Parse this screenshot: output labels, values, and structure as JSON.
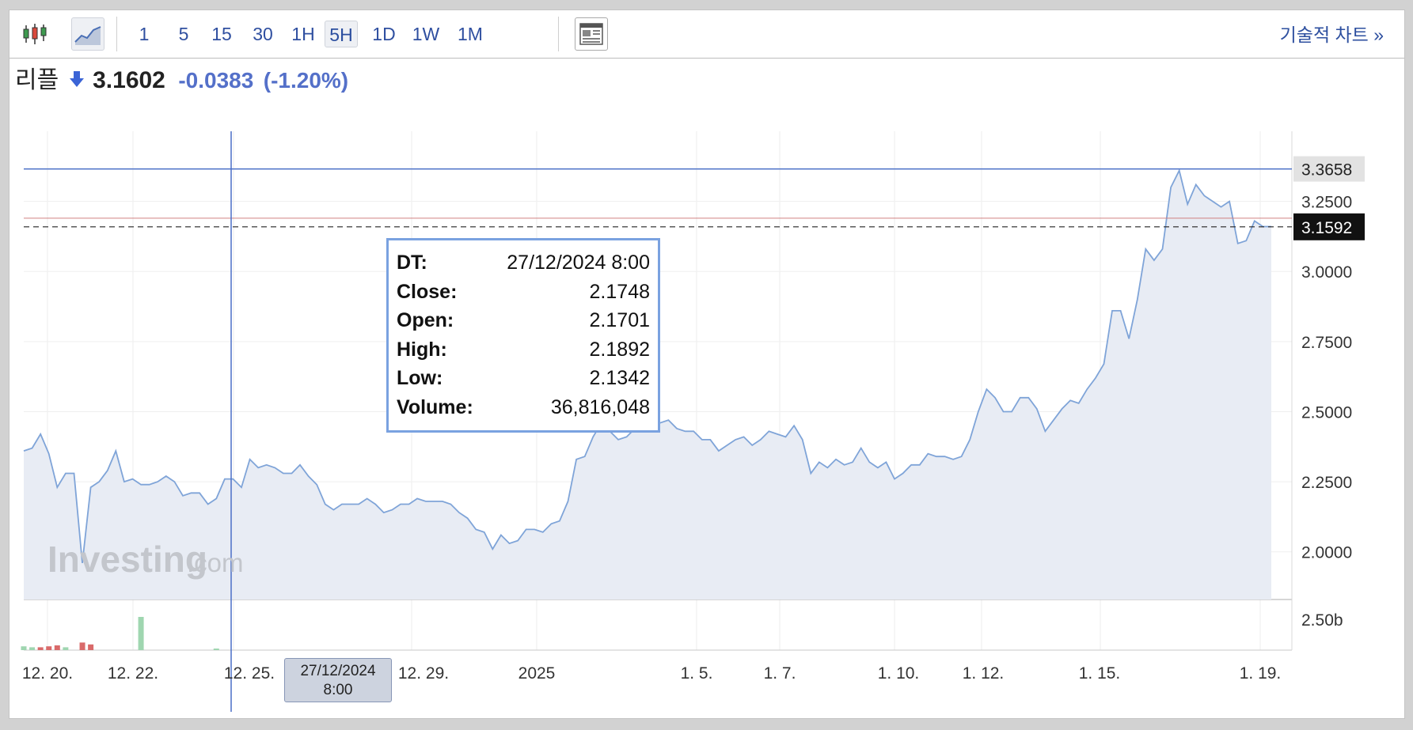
{
  "toolbar": {
    "intervals": [
      "1",
      "5",
      "15",
      "30",
      "1H",
      "5H",
      "1D",
      "1W",
      "1M"
    ],
    "active_interval": "5H",
    "tech_chart_link": "기술적 차트 »",
    "icons": [
      "candlestick-chart-icon",
      "area-chart-icon",
      "news-layout-icon"
    ]
  },
  "quote": {
    "name": "리플",
    "direction": "down",
    "price": "3.1602",
    "change": "-0.0383",
    "change_pct": "(-1.20%)"
  },
  "tooltip": {
    "rows": [
      {
        "label": "DT:",
        "value": "27/12/2024 8:00"
      },
      {
        "label": "Close:",
        "value": "2.1748"
      },
      {
        "label": "Open:",
        "value": "2.1701"
      },
      {
        "label": "High:",
        "value": "2.1892"
      },
      {
        "label": "Low:",
        "value": "2.1342"
      },
      {
        "label": "Volume:",
        "value": "36,816,048"
      }
    ]
  },
  "crosshair_label": {
    "line1": "27/12/2024",
    "line2": "8:00"
  },
  "watermark": {
    "brand": "Investing",
    "suffix": ".com"
  },
  "colors": {
    "accent": "#5470c9",
    "line": "#7fa4d8",
    "area": "#e8ecf4",
    "high_line": "#4a6fc7",
    "low_marker": "#d08080",
    "vol_up": "#9fd6b0",
    "vol_down": "#d96a6a"
  },
  "chart_data": {
    "type": "area",
    "ylim": [
      1.83,
      3.5
    ],
    "y_ticks": [
      2.0,
      2.25,
      2.5,
      2.75,
      3.0,
      3.25
    ],
    "y_tick_labels": [
      "2.0000",
      "2.2500",
      "2.5000",
      "2.7500",
      "3.0000",
      "3.2500"
    ],
    "x_tick_labels": [
      "12. 20.",
      "12. 22.",
      "12. 25.",
      "12. 29.",
      "2025",
      "1. 5.",
      "1. 7.",
      "1. 10.",
      "1. 12.",
      "1. 15.",
      "1. 19."
    ],
    "high_marker": {
      "value": 3.3658,
      "label": "3.3658"
    },
    "last_price": {
      "value": 3.1592,
      "label": "3.1592"
    },
    "volume_scale_label": "2.50b",
    "close": [
      2.36,
      2.37,
      2.42,
      2.35,
      2.23,
      2.28,
      2.28,
      1.96,
      2.23,
      2.25,
      2.29,
      2.36,
      2.25,
      2.26,
      2.24,
      2.24,
      2.25,
      2.27,
      2.25,
      2.2,
      2.21,
      2.21,
      2.17,
      2.19,
      2.26,
      2.26,
      2.23,
      2.33,
      2.3,
      2.31,
      2.3,
      2.28,
      2.28,
      2.31,
      2.27,
      2.24,
      2.17,
      2.15,
      2.17,
      2.17,
      2.17,
      2.19,
      2.17,
      2.14,
      2.15,
      2.17,
      2.17,
      2.19,
      2.18,
      2.18,
      2.18,
      2.17,
      2.14,
      2.12,
      2.08,
      2.07,
      2.01,
      2.06,
      2.03,
      2.04,
      2.08,
      2.08,
      2.07,
      2.1,
      2.11,
      2.18,
      2.33,
      2.34,
      2.41,
      2.46,
      2.43,
      2.4,
      2.41,
      2.44,
      2.46,
      2.45,
      2.46,
      2.47,
      2.44,
      2.43,
      2.43,
      2.4,
      2.4,
      2.36,
      2.38,
      2.4,
      2.41,
      2.38,
      2.4,
      2.43,
      2.42,
      2.41,
      2.45,
      2.4,
      2.28,
      2.32,
      2.3,
      2.33,
      2.31,
      2.32,
      2.37,
      2.32,
      2.3,
      2.32,
      2.26,
      2.28,
      2.31,
      2.31,
      2.35,
      2.34,
      2.34,
      2.33,
      2.34,
      2.4,
      2.5,
      2.58,
      2.55,
      2.5,
      2.5,
      2.55,
      2.55,
      2.51,
      2.43,
      2.47,
      2.51,
      2.54,
      2.53,
      2.58,
      2.62,
      2.67,
      2.86,
      2.86,
      2.76,
      2.9,
      3.08,
      3.04,
      3.08,
      3.3,
      3.36,
      3.24,
      3.31,
      3.27,
      3.25,
      3.23,
      3.25,
      3.1,
      3.11,
      3.18,
      3.16,
      3.16
    ],
    "volume": [
      0.04,
      0.03,
      0.03,
      0.04,
      0.05,
      0.03,
      0.0,
      0.08,
      0.06,
      0.0,
      0.0,
      0.0,
      0.0,
      0.0,
      0.35,
      0.0,
      0.0,
      0.0,
      0.0,
      0.0,
      0.0,
      0.0,
      0.0,
      0.01,
      0.0,
      0.0,
      0.0,
      0.0,
      0.0,
      0.0,
      0.0,
      0.0,
      0.0,
      0.0,
      0.0,
      0.0,
      0.0,
      0.0,
      0.0,
      0.0,
      0.0,
      0.0,
      0.0,
      0.0,
      0.0,
      0.0,
      0.0,
      0.0,
      0.0,
      0.0,
      0.0,
      0.0,
      0.0,
      0.0,
      0.0,
      0.0,
      0.0,
      0.0,
      0.0,
      0.0,
      0.0,
      0.0,
      0.0,
      0.0,
      0.0,
      0.0,
      0.0,
      0.0,
      0.0,
      0.0,
      0.0,
      0.0,
      0.0,
      0.0,
      0.0,
      0.0,
      0.0,
      0.0,
      0.0,
      0.0,
      0.0,
      0.0,
      0.0,
      0.0,
      0.0,
      0.0,
      0.0,
      0.0,
      0.0,
      0.0,
      0.0,
      0.0,
      0.0,
      0.0,
      0.0,
      0.0,
      0.0,
      0.0,
      0.0,
      0.0,
      0.0,
      0.0,
      0.0,
      0.0,
      0.0,
      0.0,
      0.0,
      0.0,
      0.0,
      0.0,
      0.0,
      0.0,
      0.0,
      0.0,
      0.0,
      0.0,
      0.0,
      0.0,
      0.0,
      0.0,
      0.0,
      0.0,
      0.0,
      0.0,
      0.0,
      0.0,
      0.0,
      0.0,
      0.0,
      0.0,
      0.0,
      0.0,
      0.0,
      0.0,
      0.0,
      0.0,
      0.0,
      0.0,
      0.0,
      0.0,
      0.0,
      0.0,
      0.0,
      0.0,
      0.0,
      0.0,
      0.0,
      0.0,
      0.0,
      0.0
    ],
    "volume_up": [
      true,
      true,
      false,
      false,
      false,
      true,
      true,
      false,
      false,
      true,
      true,
      true,
      true,
      true,
      true,
      true,
      true,
      true,
      true,
      true,
      true,
      true,
      true,
      true,
      true,
      true,
      true,
      true,
      true,
      true,
      true,
      true,
      true,
      true,
      true,
      true,
      true,
      true,
      true,
      true,
      true,
      true,
      true,
      true,
      true,
      true,
      true,
      true,
      true,
      true,
      true,
      true,
      true,
      true,
      true,
      true,
      true,
      true,
      true,
      true,
      true,
      true,
      true,
      true,
      true,
      true,
      true,
      true,
      true,
      true,
      true,
      true,
      true,
      true,
      true,
      true,
      true,
      true,
      true,
      true,
      true,
      true,
      true,
      true,
      true,
      true,
      true,
      true,
      true,
      true,
      true,
      true,
      true,
      true,
      true,
      true,
      true,
      true,
      true,
      true,
      true,
      true,
      true,
      true,
      true,
      true,
      true,
      true,
      true,
      true,
      true,
      true,
      true,
      true,
      true,
      true,
      true,
      true,
      true,
      true,
      true,
      true,
      true,
      true,
      true,
      true,
      true,
      true,
      true,
      true,
      true,
      true,
      true,
      true,
      true,
      true,
      true,
      true,
      true,
      true,
      true,
      true,
      true,
      true,
      true,
      true,
      true,
      true,
      true,
      true
    ]
  }
}
